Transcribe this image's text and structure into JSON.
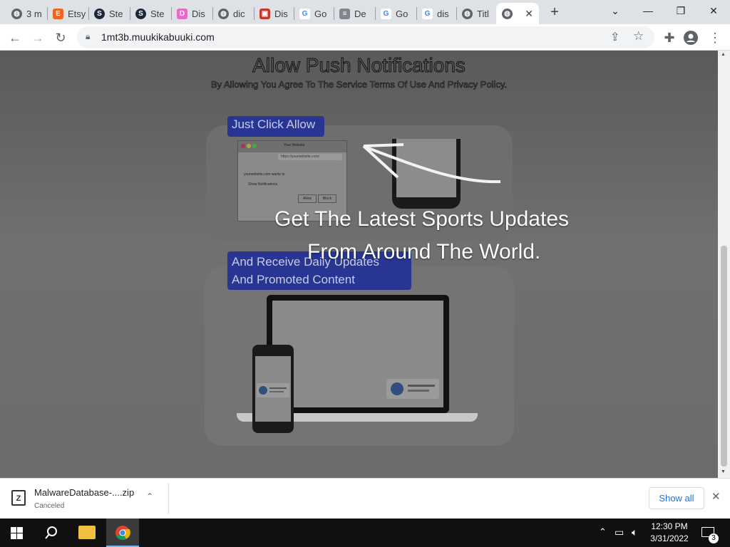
{
  "tabs": [
    {
      "label": "3 m",
      "icon": "globe-icon"
    },
    {
      "label": "Etsy",
      "icon": "etsy-icon"
    },
    {
      "label": "Ste",
      "icon": "steam-icon"
    },
    {
      "label": "Ste",
      "icon": "steam-icon"
    },
    {
      "label": "Dis",
      "icon": "discord-icon"
    },
    {
      "label": "dic",
      "icon": "globe-icon"
    },
    {
      "label": "Dis",
      "icon": "gift-icon"
    },
    {
      "label": "Go",
      "icon": "google-icon"
    },
    {
      "label": "De",
      "icon": "doc-icon"
    },
    {
      "label": "Go",
      "icon": "google-icon"
    },
    {
      "label": "dis",
      "icon": "google-icon"
    },
    {
      "label": "Titl",
      "icon": "globe-icon"
    },
    {
      "label": "",
      "icon": "globe-icon",
      "active": true
    }
  ],
  "address": {
    "url": "1mt3b.muukikabuuki.com"
  },
  "page": {
    "title": "Allow Push Notifications",
    "subtitle": "By Allowing You Agree To The Service Terms Of Use And Privacy Policy.",
    "badge1": "Just Click Allow",
    "badge2_line1": "And Receive Daily Updates",
    "badge2_line2": "And Promoted Content",
    "overlay_line1": "Get The Latest Sports Updates",
    "overlay_line2": "From Around The World.",
    "mock_browser_title": "Your Website",
    "mock_browser_url": "https://yourwebsite.com/",
    "mock_prompt": "yourwebsite.com wants to",
    "mock_notify": "Show Notifications",
    "mock_allow": "Allow",
    "mock_block": "Block"
  },
  "download": {
    "filename": "MalwareDatabase-....zip",
    "status": "Canceled",
    "show_all": "Show all"
  },
  "taskbar": {
    "time": "12:30 PM",
    "date": "3/31/2022",
    "notifications": "3"
  }
}
